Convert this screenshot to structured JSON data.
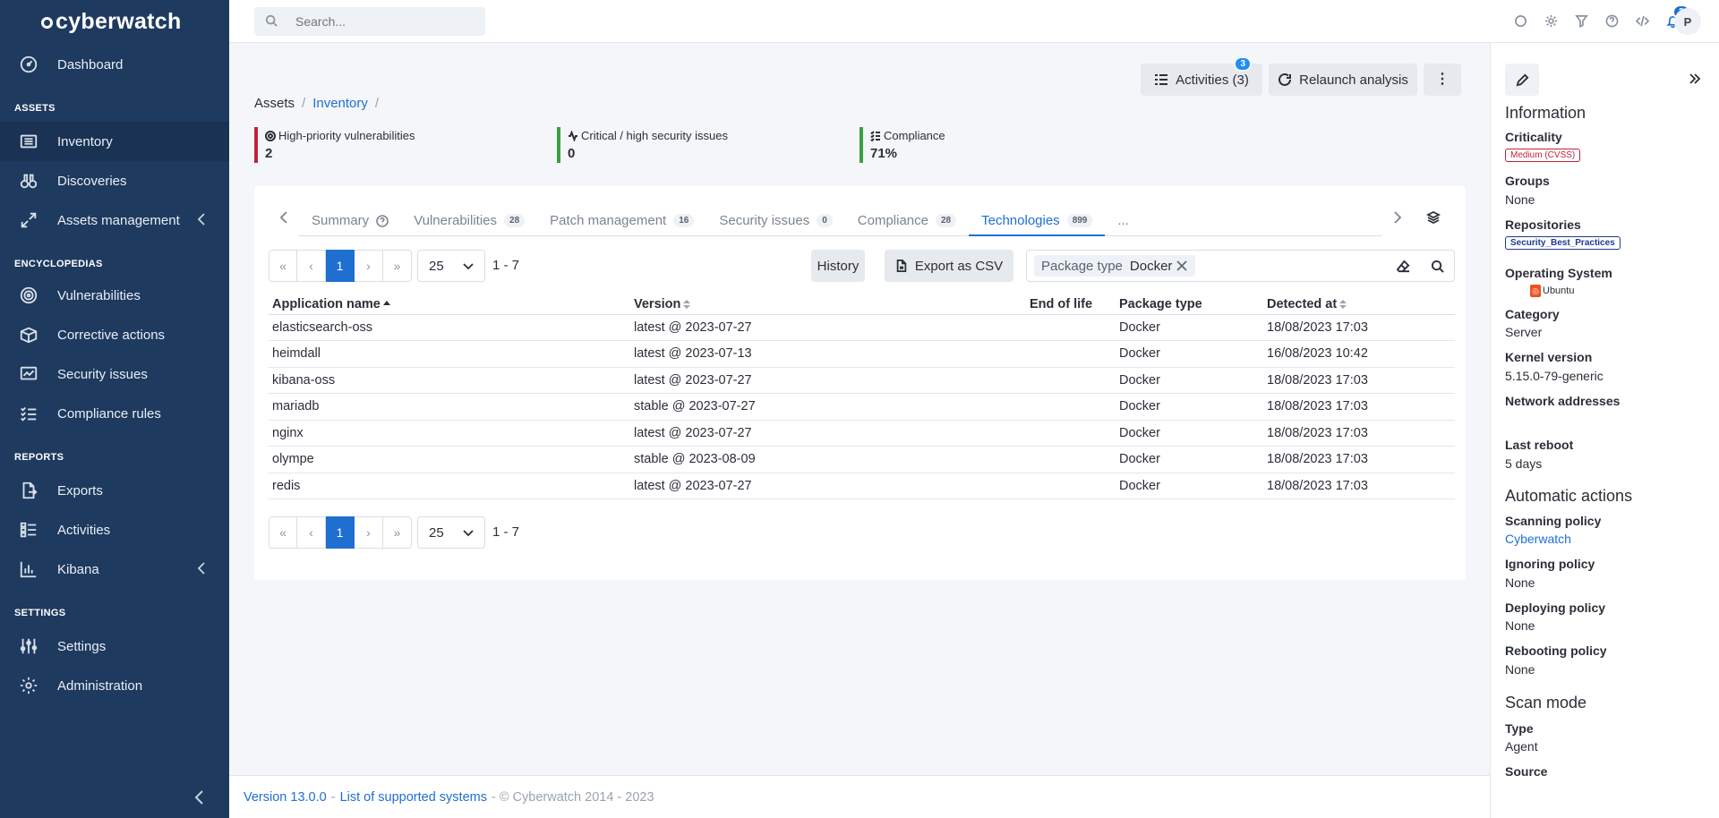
{
  "brand": {
    "name": "cyberwatch"
  },
  "sidebar": {
    "dashboard": "Dashboard",
    "sections": {
      "assets": "ASSETS",
      "encyclopedias": "ENCYCLOPEDIAS",
      "reports": "REPORTS",
      "settings": "SETTINGS"
    },
    "items": {
      "inventory": "Inventory",
      "discoveries": "Discoveries",
      "assets_management": "Assets management",
      "vulnerabilities": "Vulnerabilities",
      "corrective_actions": "Corrective actions",
      "security_issues": "Security issues",
      "compliance_rules": "Compliance rules",
      "exports": "Exports",
      "activities": "Activities",
      "kibana": "Kibana",
      "settings": "Settings",
      "administration": "Administration"
    }
  },
  "topbar": {
    "search_placeholder": "Search...",
    "notifications_count": "2",
    "avatar_initial": "P"
  },
  "actions": {
    "activities_label": "Activities (3)",
    "activities_badge": "3",
    "relaunch_label": "Relaunch analysis"
  },
  "breadcrumb": {
    "root": "Assets",
    "current": "Inventory",
    "sep": "/"
  },
  "kpis": [
    {
      "label": "High-priority vulnerabilities",
      "value": "2",
      "color": "#c0233c"
    },
    {
      "label": "Critical / high security issues",
      "value": "0",
      "color": "#3aa041"
    },
    {
      "label": "Compliance",
      "value": "71%",
      "color": "#3aa041"
    }
  ],
  "tabs": [
    {
      "label": "Summary",
      "count": ""
    },
    {
      "label": "Vulnerabilities",
      "count": "28"
    },
    {
      "label": "Patch management",
      "count": "16"
    },
    {
      "label": "Security issues",
      "count": "0"
    },
    {
      "label": "Compliance",
      "count": "28"
    },
    {
      "label": "Technologies",
      "count": "899"
    },
    {
      "label": "...",
      "count": ""
    }
  ],
  "pagination": {
    "first": "«",
    "prev": "‹",
    "current": "1",
    "next": "›",
    "last": "»",
    "per_page": "25",
    "range": "1 - 7"
  },
  "toolbar": {
    "history": "History",
    "export_csv": "Export as CSV"
  },
  "filter": {
    "key": "Package type",
    "value": "Docker"
  },
  "table": {
    "headers": [
      "Application name",
      "Version",
      "End of life",
      "Package type",
      "Detected at"
    ],
    "rows": [
      [
        "elasticsearch-oss",
        "latest @ 2023-07-27",
        "",
        "Docker",
        "18/08/2023 17:03"
      ],
      [
        "heimdall",
        "latest @ 2023-07-13",
        "",
        "Docker",
        "16/08/2023 10:42"
      ],
      [
        "kibana-oss",
        "latest @ 2023-07-27",
        "",
        "Docker",
        "18/08/2023 17:03"
      ],
      [
        "mariadb",
        "stable @ 2023-07-27",
        "",
        "Docker",
        "18/08/2023 17:03"
      ],
      [
        "nginx",
        "latest @ 2023-07-27",
        "",
        "Docker",
        "18/08/2023 17:03"
      ],
      [
        "olympe",
        "stable @ 2023-08-09",
        "",
        "Docker",
        "18/08/2023 17:03"
      ],
      [
        "redis",
        "latest @ 2023-07-27",
        "",
        "Docker",
        "18/08/2023 17:03"
      ]
    ]
  },
  "info_panel": {
    "information_title": "Information",
    "criticality_label": "Criticality",
    "criticality_value": "Medium (CVSS)",
    "groups_label": "Groups",
    "groups_value": "None",
    "repositories_label": "Repositories",
    "repositories_value": "Security_Best_Practices",
    "os_label": "Operating System",
    "os_value": "Ubuntu",
    "category_label": "Category",
    "category_value": "Server",
    "kernel_label": "Kernel version",
    "kernel_value": "5.15.0-79-generic",
    "network_label": "Network addresses",
    "reboot_label": "Last reboot",
    "reboot_value": "5 days",
    "auto_title": "Automatic actions",
    "scanning_label": "Scanning policy",
    "scanning_value": "Cyberwatch",
    "ignoring_label": "Ignoring policy",
    "ignoring_value": "None",
    "deploying_label": "Deploying policy",
    "deploying_value": "None",
    "rebooting_label": "Rebooting policy",
    "rebooting_value": "None",
    "scan_mode_title": "Scan mode",
    "type_label": "Type",
    "type_value": "Agent",
    "source_label": "Source"
  },
  "footer": {
    "version": "Version 13.0.0",
    "dash": "-",
    "supported": "List of supported systems",
    "copyright": "- © Cyberwatch 2014 - 2023"
  },
  "colors": {
    "sidebar_bg": "#1f3a5f",
    "accent": "#1f6fd1"
  }
}
